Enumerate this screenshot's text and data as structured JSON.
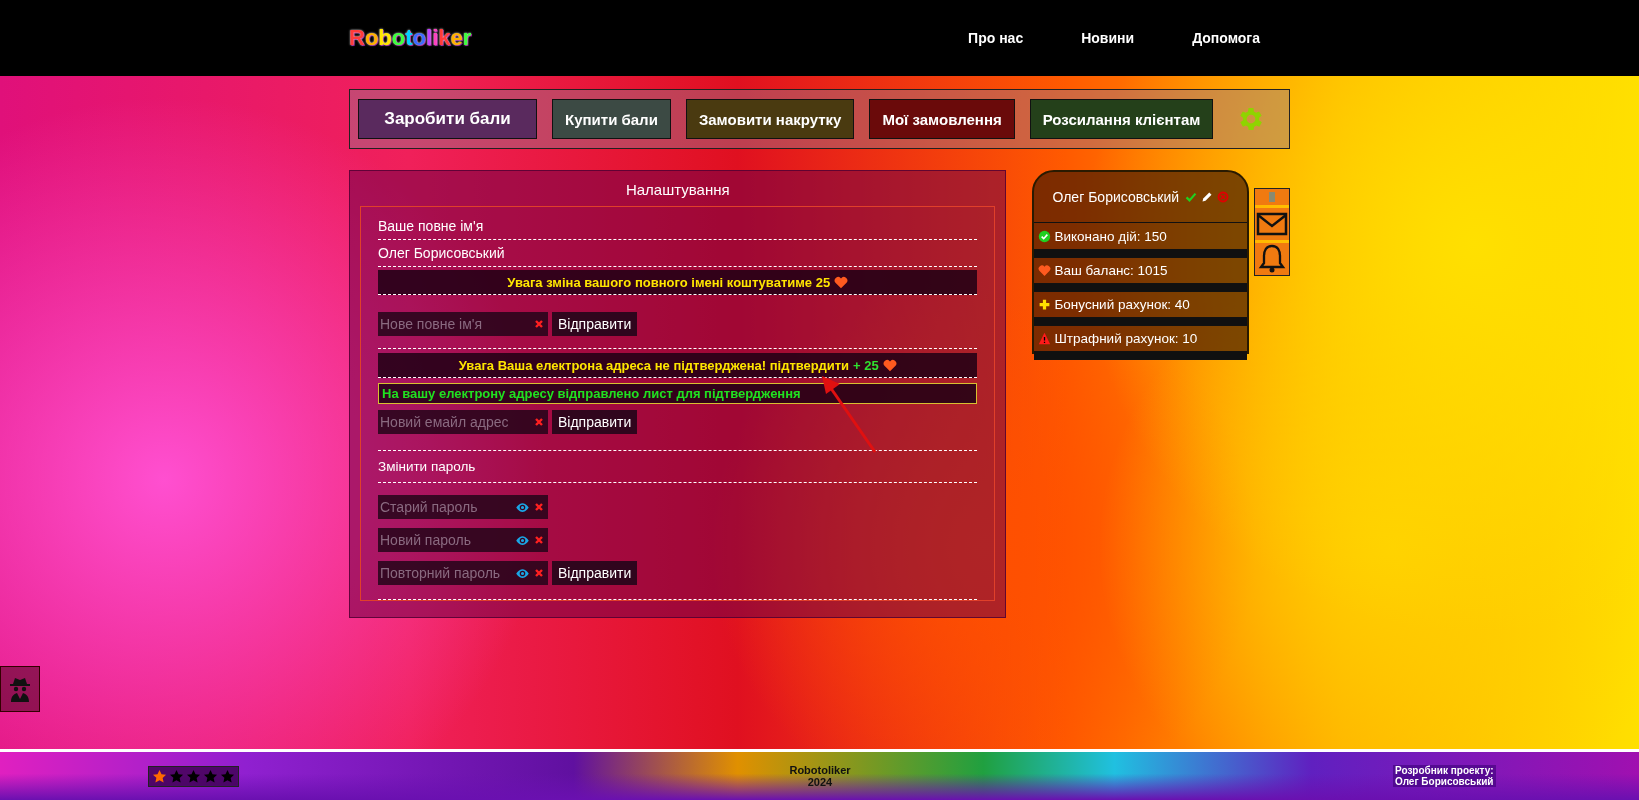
{
  "header": {
    "logo": "Robotoliker",
    "nav": [
      {
        "label": "Про нас"
      },
      {
        "label": "Новини"
      },
      {
        "label": "Допомога"
      }
    ]
  },
  "menu": {
    "buttons": [
      {
        "label": "Заробити бали",
        "color": "#5a2a5e"
      },
      {
        "label": "Купити бали",
        "color": "#3c4a44"
      },
      {
        "label": "Замовити накрутку",
        "color": "#4a3a10"
      },
      {
        "label": "Мої замовлення",
        "color": "#6a0a0a"
      },
      {
        "label": "Розсилання клієнтам",
        "color": "#24401a"
      }
    ]
  },
  "settings": {
    "title": "Налаштування",
    "name_section": {
      "label": "Ваше повне ім'я",
      "value": "Олег Борисовський",
      "warning": "Увага зміна вашого повного імені коштуватиме 25",
      "field": {
        "placeholder": "Нове повне ім'я"
      },
      "submit": "Відправити"
    },
    "email_section": {
      "warning": "Увага Ваша електрона адреса не підтверджена! підтвердити",
      "bonus": "+ 25",
      "notice": "На вашу електрону адресу відправлено лист для підтвердження",
      "field": {
        "placeholder": "Новий емайл адрес"
      },
      "submit": "Відправити"
    },
    "password_section": {
      "label": "Змінити пароль",
      "fields": [
        {
          "placeholder": "Старий пароль"
        },
        {
          "placeholder": "Новий пароль"
        },
        {
          "placeholder": "Повторний пароль"
        }
      ],
      "submit": "Відправити"
    }
  },
  "profile": {
    "name": "Олег Борисовський",
    "stats": [
      {
        "kind": "done",
        "text": "Виконано дій: 150"
      },
      {
        "kind": "balance",
        "text": "Ваш баланс: 1015"
      },
      {
        "kind": "bonus",
        "text": "Бонусний рахунок: 40"
      },
      {
        "kind": "penalty",
        "text": "Штрафний рахунок: 10"
      }
    ]
  },
  "footer": {
    "stars": 1,
    "brand": "Robotoliker",
    "year": "2024",
    "developer_label": "Розробник проекту:",
    "developer_name": "Олег Борисовський"
  }
}
